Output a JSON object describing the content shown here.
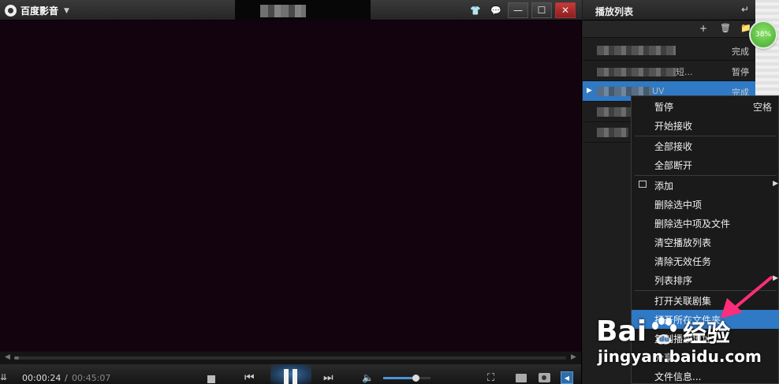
{
  "window": {
    "app_name": "百度影音",
    "menu_caret": "▼"
  },
  "title_buttons": {
    "skin": "👕",
    "message": "💬",
    "minimize": "—",
    "maximize": "☐",
    "close": "✕"
  },
  "controls": {
    "current_time": "00:00:24",
    "separator": "/",
    "total_time": "00:45:07",
    "seek_progress_fraction": 0.009,
    "volume_fraction": 0.68,
    "prev": "⏮",
    "next": "⏭",
    "volume_icon": "🔈",
    "fullscreen": "⛶",
    "playlist_toggle": "◀",
    "download_icon": "⇊"
  },
  "playlist": {
    "title": "播放列表",
    "back_icon": "↵",
    "tools": {
      "add": "+",
      "delete": "🗑",
      "folder": "📁"
    },
    "items": [
      {
        "name_suffix": "",
        "status": "完成",
        "selected": false
      },
      {
        "name_suffix": "短...",
        "status": "暂停",
        "selected": false
      },
      {
        "name_suffix": "UV",
        "status": "完成",
        "selected": true
      },
      {
        "name_suffix": "",
        "status": "",
        "selected": false
      },
      {
        "name_suffix": "",
        "status": "",
        "selected": false
      }
    ],
    "play_mark": "▶"
  },
  "badge": {
    "percent": "38%"
  },
  "context_menu": {
    "items": [
      {
        "label": "暂停",
        "shortcut": "空格"
      },
      {
        "label": "开始接收"
      },
      {
        "label": "全部接收"
      },
      {
        "label": "全部断开"
      },
      {
        "label": "添加",
        "submenu": "▶"
      },
      {
        "label": "删除选中项"
      },
      {
        "label": "删除选中项及文件"
      },
      {
        "label": "清空播放列表"
      },
      {
        "label": "清除无效任务"
      },
      {
        "label": "列表排序",
        "submenu": "▶"
      },
      {
        "label": "打开关联剧集"
      },
      {
        "label": "打开所在文件夹"
      },
      {
        "label": "复制播放地址"
      },
      {
        "label": "分享"
      },
      {
        "label": "文件信息..."
      }
    ]
  },
  "watermark": {
    "brand_left": "Bai",
    "brand_right": "经验",
    "url": "jingyan.baidu.com"
  },
  "colors": {
    "accent_blue": "#2f79c5",
    "video_bg": "#13030f",
    "arrow_pink": "#ff2d7a",
    "badge_green": "#4cb534"
  }
}
